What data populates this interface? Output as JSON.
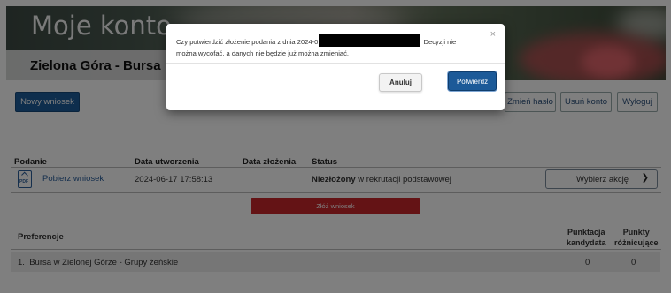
{
  "header": {
    "title": "Moje konto",
    "organization": "Zielona Góra - Bursa"
  },
  "toolbar": {
    "new_application": "Nowy wniosek",
    "change_password": "Zmień hasło",
    "delete_account": "Usuń konto",
    "logout": "Wyloguj"
  },
  "table": {
    "headers": [
      "Podanie",
      "Data utworzenia",
      "Data złożenia",
      "Status"
    ],
    "row": {
      "download": "Pobierz wniosek",
      "created": "2024-06-17 17:58:13",
      "submitted": "",
      "status_bold": "Niezłożony",
      "status_rest": " w rekrutacji podstawowej",
      "action_select": "Wybierz akcję"
    },
    "submit_button": "Złóż wniosek",
    "pdf_label": "PDF"
  },
  "preferences": {
    "title": "Preferencje",
    "col_score": [
      "Punktacja",
      "kandydata"
    ],
    "col_diff": [
      "Punkty",
      "różnicujące"
    ],
    "items": [
      {
        "index": "1.",
        "name": "Bursa w Zielonej Górze - Grupy żeńskie",
        "score": "0",
        "diff": "0"
      }
    ]
  },
  "modal": {
    "text_before": "Czy potwierdzić złożenie podania z dnia 2024-0",
    "text_after": " Decyzji nie można wycofać, a danych nie będzie już można zmieniać.",
    "close": "×",
    "cancel": "Anuluj",
    "confirm": "Potwierdź"
  },
  "icons": {
    "close": "close-icon",
    "chevron": "chevron-down-icon",
    "pdf": "pdf-file-icon"
  },
  "colors": {
    "primary": "#1d5d9b",
    "danger": "#c8262b"
  }
}
